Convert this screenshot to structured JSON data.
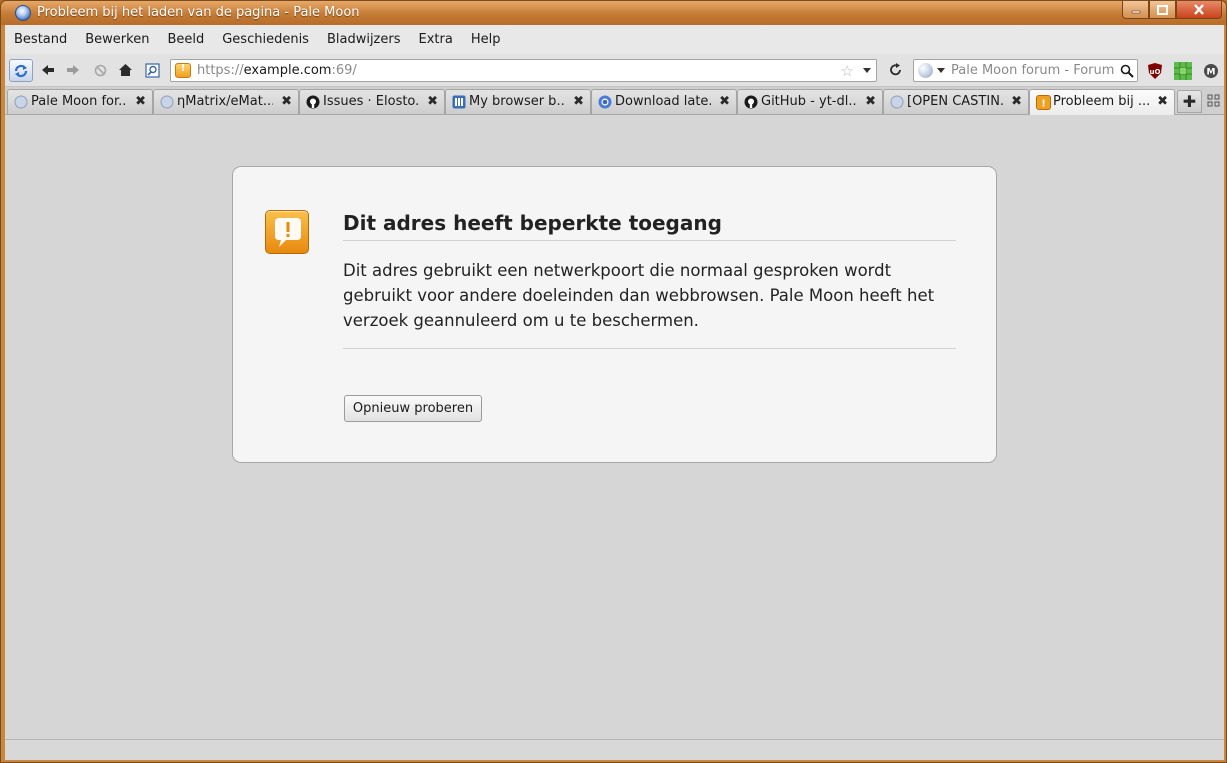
{
  "window": {
    "title": "Probleem bij het laden van de pagina - Pale Moon"
  },
  "menubar": {
    "items": [
      "Bestand",
      "Bewerken",
      "Beeld",
      "Geschiedenis",
      "Bladwijzers",
      "Extra",
      "Help"
    ]
  },
  "navbar": {
    "url_proto": "https://",
    "url_host": "example.com",
    "url_rest": ":69/",
    "search_placeholder": "Pale Moon forum - Forum in"
  },
  "tabs": [
    {
      "label": "Pale Moon for...",
      "icon": "pale-moon-icon",
      "selected": false
    },
    {
      "label": "ηMatrix/eMat...",
      "icon": "pale-moon-icon",
      "selected": false
    },
    {
      "label": "Issues · Elosto...",
      "icon": "github-icon",
      "selected": false
    },
    {
      "label": "My browser b...",
      "icon": "forum-icon",
      "selected": false
    },
    {
      "label": "Download late...",
      "icon": "chrome-icon",
      "selected": false
    },
    {
      "label": "GitHub - yt-dl...",
      "icon": "github-icon",
      "selected": false
    },
    {
      "label": "[OPEN CASTIN...",
      "icon": "pale-moon-icon",
      "selected": false
    },
    {
      "label": "Probleem bij ...",
      "icon": "warning-icon",
      "selected": true
    }
  ],
  "error": {
    "title": "Dit adres heeft beperkte toegang",
    "description": "Dit adres gebruikt een netwerkpoort die normaal gesproken wordt gebruikt voor andere doeleinden dan webbrowsen. Pale Moon heeft het verzoek geannuleerd om u te beschermen.",
    "retry_label": "Opnieuw proberen"
  },
  "colors": {
    "titlebar": "#c47b36",
    "warning_accent": "#f0a020"
  }
}
